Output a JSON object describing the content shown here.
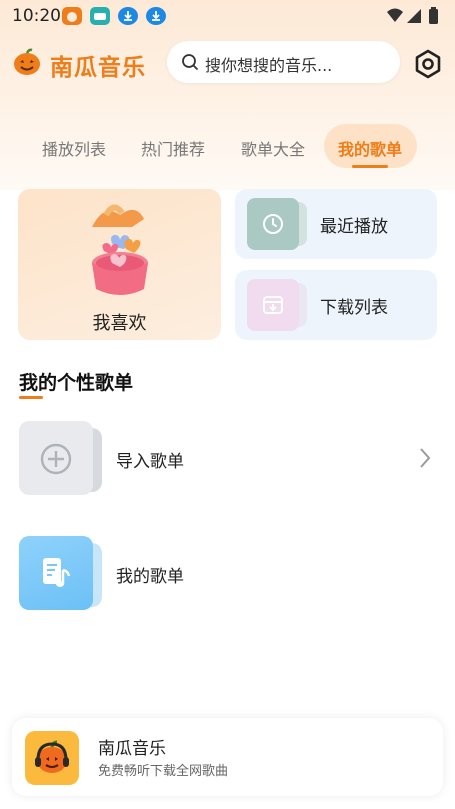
{
  "status_bar": {
    "time": "10:20"
  },
  "header": {
    "app_name": "南瓜音乐",
    "search_placeholder": "搜你想搜的音乐..."
  },
  "tabs": [
    {
      "label": "播放列表",
      "active": false
    },
    {
      "label": "热门推荐",
      "active": false
    },
    {
      "label": "歌单大全",
      "active": false
    },
    {
      "label": "我的歌单",
      "active": true
    }
  ],
  "cards": {
    "favorites": "我喜欢",
    "recent": "最近播放",
    "downloads": "下载列表"
  },
  "section": {
    "title": "我的个性歌单",
    "playlists": [
      {
        "label": "导入歌单"
      },
      {
        "label": "我的歌单"
      }
    ]
  },
  "player": {
    "title": "南瓜音乐",
    "subtitle": "免费畅听下载全网歌曲"
  },
  "colors": {
    "accent": "#ef7d1a",
    "tab_pill": "#fde2c7",
    "card_bg": "#edf4fb"
  }
}
